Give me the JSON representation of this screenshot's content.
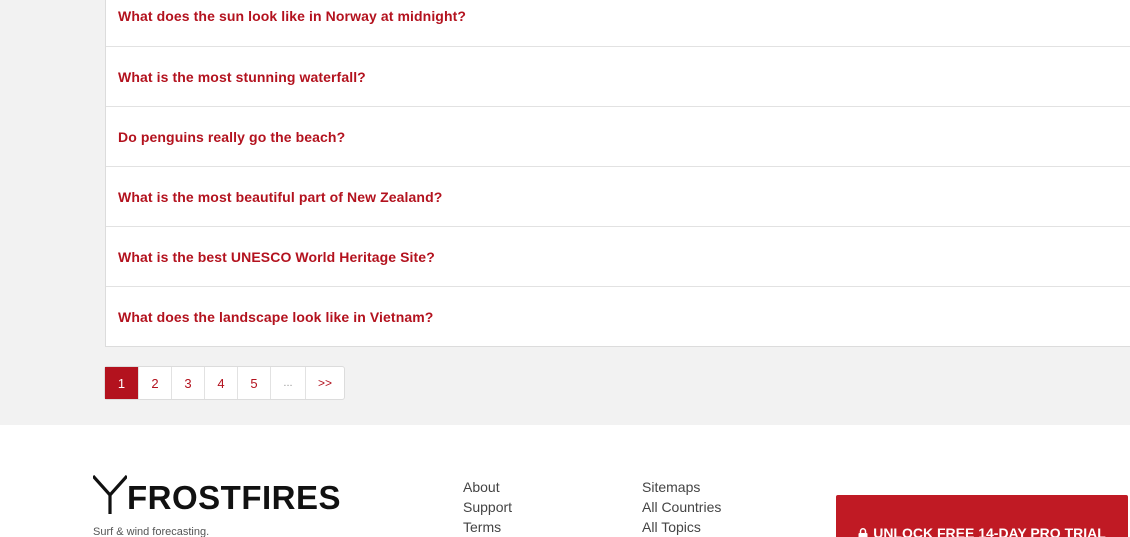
{
  "questions": [
    "What does the sun look like in Norway at midnight?",
    "What is the most stunning waterfall?",
    "Do penguins really go the beach?",
    "What is the most beautiful part of New Zealand?",
    "What is the best UNESCO World Heritage Site?",
    "What does the landscape look like in Vietnam?"
  ],
  "pagination": {
    "pages": [
      "1",
      "2",
      "3",
      "4",
      "5"
    ],
    "current": "1",
    "ellipsis": "...",
    "next": ">>"
  },
  "footer": {
    "brand": "FROSTFIRES",
    "tagline": "Surf & wind forecasting.",
    "col1": [
      "About",
      "Support",
      "Terms"
    ],
    "col2": [
      "Sitemaps",
      "All Countries",
      "All Topics"
    ],
    "cta": "UNLOCK FREE 14-DAY PRO TRIAL"
  },
  "colors": {
    "accent": "#b3121e",
    "cta": "#c01a24"
  }
}
